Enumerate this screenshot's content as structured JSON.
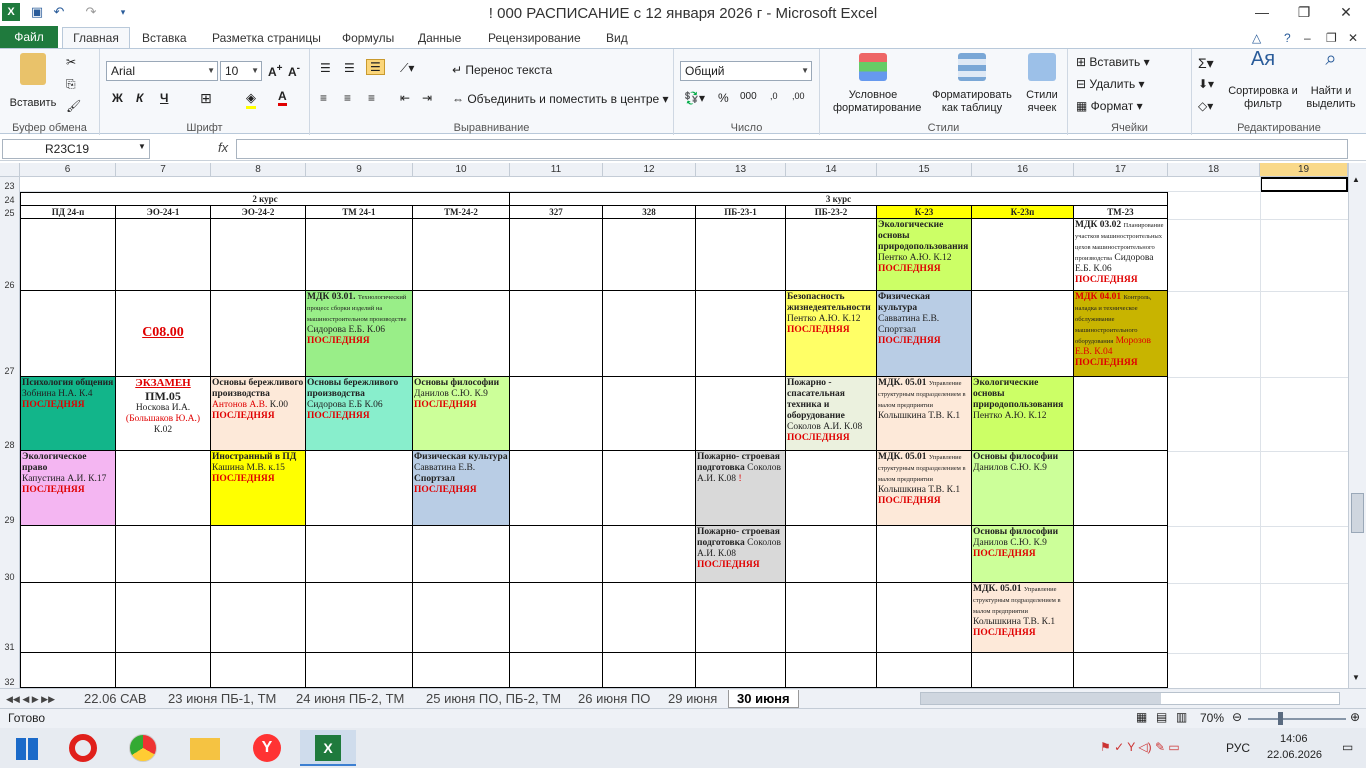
{
  "window": {
    "title": "! 000 РАСПИСАНИЕ с 12 января 2026 г  -  Microsoft Excel"
  },
  "tabs": [
    "Файл",
    "Главная",
    "Вставка",
    "Разметка страницы",
    "Формулы",
    "Данные",
    "Рецензирование",
    "Вид"
  ],
  "ribbon": {
    "clipboard": {
      "paste": "Вставить",
      "label": "Буфер обмена"
    },
    "font": {
      "name": "Arial",
      "size": "10",
      "bold": "Ж",
      "italic": "К",
      "underline": "Ч",
      "label": "Шрифт"
    },
    "align": {
      "wrap": "Перенос текста",
      "merge": "Объединить и поместить в центре",
      "label": "Выравнивание"
    },
    "number": {
      "format": "Общий",
      "label": "Число"
    },
    "styles": {
      "cond": "Условное форматирование",
      "table": "Форматировать как таблицу",
      "cell": "Стили ячеек",
      "label": "Стили"
    },
    "cells": {
      "insert": "Вставить",
      "delete": "Удалить",
      "format": "Формат",
      "label": "Ячейки"
    },
    "edit": {
      "sort": "Сортировка и фильтр",
      "find": "Найти и выделить",
      "label": "Редактирование"
    }
  },
  "formula": {
    "namebox": "R23C19",
    "fx": "fx",
    "value": ""
  },
  "columns": [
    "6",
    "7",
    "8",
    "9",
    "10",
    "11",
    "12",
    "13",
    "14",
    "15",
    "16",
    "17",
    "18",
    "19"
  ],
  "rows": [
    "23",
    "24",
    "25",
    "26",
    "27",
    "28",
    "29",
    "30",
    "31",
    "32"
  ],
  "course_labels": [
    "2 курс",
    "3 курс"
  ],
  "groups": [
    "ПД 24-п",
    "ЭО-24-1",
    "ЭО-24-2",
    "ТМ 24-1",
    "ТМ-24-2",
    "327",
    "328",
    "ПБ-23-1",
    "ПБ-23-2",
    "К-23",
    "К-23п",
    "ТМ-23"
  ],
  "cells": {
    "r26_k23": [
      "Экологические основы природопользования",
      "Пентко А.Ю. К.12",
      "ПОСЛЕДНЯЯ"
    ],
    "r26_tm23": [
      "МДК 03.02",
      "Планирование участков машиностроительных цехов машиностроительного производства",
      "Сидорова Е.Б. К.06",
      "ПОСЛЕДНЯЯ"
    ],
    "r27_tm241": [
      "МДК 03.01.",
      "Технологический процесс сборки изделий на машиностроительном производстве",
      "Сидорова Е.Б. К.06",
      "ПОСЛЕДНЯЯ"
    ],
    "r27_eo241": "С08.00",
    "r27_pb232": [
      "Безопасность жизнедеятельности",
      "Пентко А.Ю. К.12",
      "ПОСЛЕДНЯЯ"
    ],
    "r27_k23": [
      "Физическая культура",
      "Савватина Е.В. Спортзал",
      "ПОСЛЕДНЯЯ"
    ],
    "r27_tm23": [
      "МДК 04.01",
      "Контроль, наладка и техническое обслуживание машиностроительного оборудования",
      "Морозов Е.В. К.04",
      "ПОСЛЕДНЯЯ"
    ],
    "r28_pd24": [
      "Психология общения",
      "Зобнина Н.А. К.4",
      "ПОСЛЕДНЯЯ"
    ],
    "r28_eo241": [
      "ЭКЗАМЕН",
      "ПМ.05",
      "Носкова И.А.",
      "(Большаков Ю.А.)",
      "К.02"
    ],
    "r28_eo242": [
      "Основы бережливого производства",
      "Антонов А.В.",
      "К.00",
      "ПОСЛЕДНЯЯ"
    ],
    "r28_tm241": [
      "Основы бережливого производства",
      "Сидорова Е.Б К.06",
      "ПОСЛЕДНЯЯ"
    ],
    "r28_tm242": [
      "Основы философии",
      "Данилов С.Ю. К.9",
      "ПОСЛЕДНЯЯ"
    ],
    "r28_pb232": [
      "Пожарно - спасательная техника и оборудование",
      "Соколов А.И. К.08",
      "ПОСЛЕДНЯЯ"
    ],
    "r28_k23": [
      "МДК. 05.01",
      "Управление структурным подразделением в малом предприятии",
      "Колышкина Т.В. К.1"
    ],
    "r28_k23p": [
      "Экологические основы природопользования",
      "Пентко А.Ю. К.12"
    ],
    "r29_pd24": [
      "Экологическое право",
      "Капустина А.И. К.17",
      "ПОСЛЕДНЯЯ"
    ],
    "r29_eo242": [
      "Иностранный в ПД",
      "Кашина М.В. к.15",
      "ПОСЛЕДНЯЯ"
    ],
    "r29_tm242": [
      "Физическая культура",
      "Савватина Е.В.",
      "Спортзал",
      "ПОСЛЕДНЯЯ"
    ],
    "r29_pb231": [
      "Пожарно- строевая подготовка",
      "Соколов А.И. К.08",
      "!"
    ],
    "r29_k23": [
      "МДК. 05.01",
      "Управление структурным подразделением в малом предприятии",
      "Колышкина Т.В. К.1",
      "ПОСЛЕДНЯЯ"
    ],
    "r29_k23p": [
      "Основы философии",
      "Данилов С.Ю. К.9"
    ],
    "r30_pb231": [
      "Пожарно- строевая подготовка",
      "Соколов А.И. К.08",
      "ПОСЛЕДНЯЯ"
    ],
    "r30_k23p": [
      "Основы философии",
      "Данилов С.Ю. К.9",
      "ПОСЛЕДНЯЯ"
    ],
    "r31_k23p": [
      "МДК. 05.01",
      "Управление структурным подразделением в малом предприятии",
      "Колышкина Т.В. К.1",
      "ПОСЛЕДНЯЯ"
    ]
  },
  "sheets": [
    "22.06 САВ",
    "23 июня ПБ-1, ТМ",
    "24 июня ПБ-2, ТМ",
    "25 июня ПО, ПБ-2, ТМ",
    "26 июня ПО",
    "29 июня",
    "30 июня"
  ],
  "status": {
    "ready": "Готово",
    "zoom": "70%"
  },
  "taskbar": {
    "lang": "РУС",
    "time": "14:06",
    "date": "22.06.2026"
  },
  "colors": {
    "green": "#1f7a3d",
    "yellow": "#ffff00",
    "lime": "#ccff66",
    "blue": "#b9cde5",
    "teal": "#12b58a",
    "pink": "#f4b6f2",
    "peach": "#fde9d9",
    "grey": "#d9d9d9",
    "olive": "#c8b400"
  }
}
